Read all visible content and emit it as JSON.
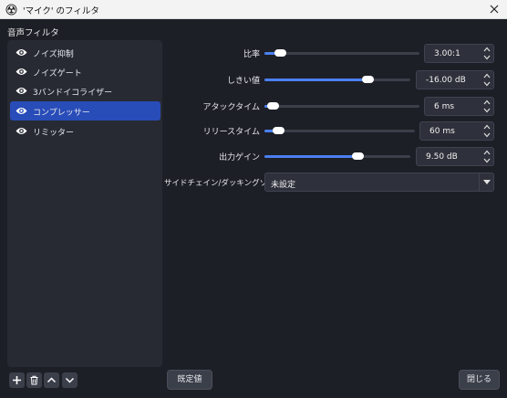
{
  "window": {
    "title": "'マイク' のフィルタ"
  },
  "filters_section": {
    "label": "音声フィルタ",
    "items": [
      {
        "label": "ノイズ抑制",
        "visible": true,
        "selected": false
      },
      {
        "label": "ノイズゲート",
        "visible": true,
        "selected": false
      },
      {
        "label": "3バンドイコライザー",
        "visible": true,
        "selected": false
      },
      {
        "label": "コンプレッサー",
        "visible": true,
        "selected": true
      },
      {
        "label": "リミッター",
        "visible": true,
        "selected": false
      }
    ]
  },
  "properties": {
    "ratio": {
      "label": "比率",
      "value": "3.00:1",
      "level": 0.07
    },
    "threshold": {
      "label": "しきい値",
      "value": "-16.00 dB",
      "level": 0.73
    },
    "attack": {
      "label": "アタックタイム",
      "value": "6 ms",
      "level": 0.02
    },
    "release": {
      "label": "リリースタイム",
      "value": "60 ms",
      "level": 0.06
    },
    "output_gain": {
      "label": "出力ゲイン",
      "value": "9.50 dB",
      "level": 0.65
    },
    "sidechain": {
      "label": "サイドチェイン/ダッキングソース",
      "value": "未設定"
    }
  },
  "buttons": {
    "defaults": "既定値",
    "close": "閉じる"
  },
  "colors": {
    "accent": "#4a7ff0",
    "selected": "#284cb8",
    "background": "#1d1f26",
    "panel": "#272a33"
  }
}
